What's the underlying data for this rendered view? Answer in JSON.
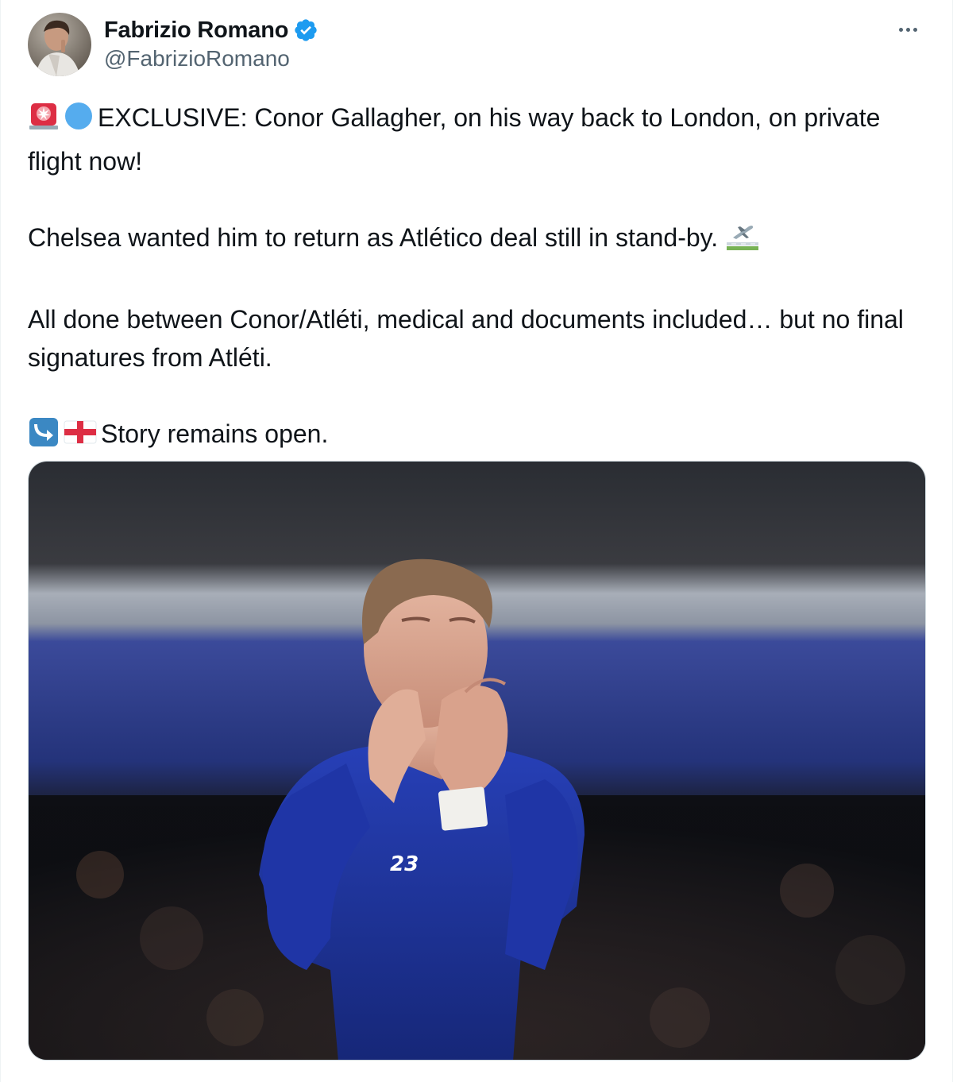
{
  "author": {
    "display_name": "Fabrizio Romano",
    "handle": "@FabrizioRomano",
    "verified": true
  },
  "tweet": {
    "line1": "EXCLUSIVE: Conor Gallagher, on his way back to London, on private flight now!",
    "line2": "Chelsea wanted him to return as Atlético deal still in stand-by.",
    "line3": "All done between Conor/Atléti, medical and documents included… but no final signatures from Atléti.",
    "line4": "Story remains open."
  },
  "icons": {
    "siren": "police-car-light-emoji",
    "blue_circle": "blue-circle-emoji",
    "plane": "airplane-departure-emoji",
    "return_arrow": "right-arrow-curving-left-emoji",
    "england_flag": "england-flag-emoji",
    "more": "more-horizontal-icon",
    "verified": "verified-badge-icon"
  },
  "media": {
    "shirt_number": "23"
  },
  "colors": {
    "accent": "#1d9bf0",
    "text": "#0f1419",
    "secondary": "#536471",
    "border": "#cfd9de",
    "kit_blue": "#1f35a6"
  }
}
